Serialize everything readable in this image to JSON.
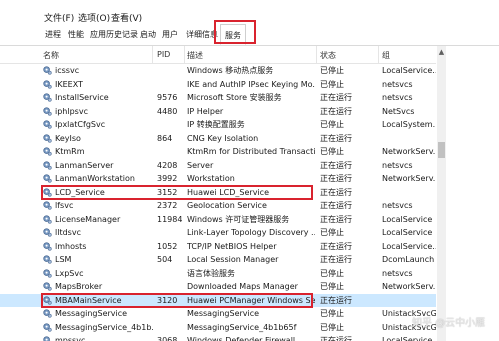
{
  "menu": {
    "file": "文件(F)",
    "options": "选项(O)",
    "view": "查看(V)"
  },
  "tabs": [
    "进程",
    "性能",
    "应用历史记录",
    "启动",
    "用户",
    "详细信息",
    "服务"
  ],
  "active_tab": "服务",
  "columns": {
    "name": "名称",
    "pid": "PID",
    "desc": "描述",
    "status": "状态",
    "group": "组"
  },
  "rows": [
    {
      "name": "icssvc",
      "pid": "",
      "desc": "Windows 移动热点服务",
      "status": "已停止",
      "group": "LocalService..."
    },
    {
      "name": "IKEEXT",
      "pid": "",
      "desc": "IKE and AuthIP IPsec Keying Mo...",
      "status": "已停止",
      "group": "netsvcs"
    },
    {
      "name": "InstallService",
      "pid": "9576",
      "desc": "Microsoft Store 安装服务",
      "status": "正在运行",
      "group": "netsvcs"
    },
    {
      "name": "iphlpsvc",
      "pid": "4480",
      "desc": "IP Helper",
      "status": "正在运行",
      "group": "NetSvcs"
    },
    {
      "name": "IpxlatCfgSvc",
      "pid": "",
      "desc": "IP 转换配置服务",
      "status": "已停止",
      "group": "LocalSystem..."
    },
    {
      "name": "KeyIso",
      "pid": "864",
      "desc": "CNG Key Isolation",
      "status": "正在运行",
      "group": ""
    },
    {
      "name": "KtmRm",
      "pid": "",
      "desc": "KtmRm for Distributed Transacti...",
      "status": "已停止",
      "group": "NetworkServ..."
    },
    {
      "name": "LanmanServer",
      "pid": "4208",
      "desc": "Server",
      "status": "正在运行",
      "group": "netsvcs"
    },
    {
      "name": "LanmanWorkstation",
      "pid": "3992",
      "desc": "Workstation",
      "status": "正在运行",
      "group": "NetworkServ..."
    },
    {
      "name": "LCD_Service",
      "pid": "3152",
      "desc": "Huawei LCD_Service",
      "status": "正在运行",
      "group": ""
    },
    {
      "name": "lfsvc",
      "pid": "2372",
      "desc": "Geolocation Service",
      "status": "正在运行",
      "group": "netsvcs"
    },
    {
      "name": "LicenseManager",
      "pid": "11984",
      "desc": "Windows 许可证管理器服务",
      "status": "正在运行",
      "group": "LocalService"
    },
    {
      "name": "lltdsvc",
      "pid": "",
      "desc": "Link-Layer Topology Discovery ...",
      "status": "已停止",
      "group": "LocalService"
    },
    {
      "name": "lmhosts",
      "pid": "1052",
      "desc": "TCP/IP NetBIOS Helper",
      "status": "正在运行",
      "group": "LocalService..."
    },
    {
      "name": "LSM",
      "pid": "504",
      "desc": "Local Session Manager",
      "status": "正在运行",
      "group": "DcomLaunch"
    },
    {
      "name": "LxpSvc",
      "pid": "",
      "desc": "语言体验服务",
      "status": "已停止",
      "group": "netsvcs"
    },
    {
      "name": "MapsBroker",
      "pid": "",
      "desc": "Downloaded Maps Manager",
      "status": "已停止",
      "group": "NetworkServ..."
    },
    {
      "name": "MBAMainService",
      "pid": "3120",
      "desc": "Huawei PCManager Windows Se...",
      "status": "正在运行",
      "group": ""
    },
    {
      "name": "MessagingService",
      "pid": "",
      "desc": "MessagingService",
      "status": "已停止",
      "group": "UnistackSvcG..."
    },
    {
      "name": "MessagingService_4b1b...",
      "pid": "",
      "desc": "MessagingService_4b1b65f",
      "status": "已停止",
      "group": "UnistackSvcG..."
    },
    {
      "name": "mpssvc",
      "pid": "3068",
      "desc": "Windows Defender Firewall",
      "status": "正在运行",
      "group": "LocalService..."
    }
  ],
  "watermark": "知乎 @云中小雁",
  "colors": {
    "highlight_box": "#d9232e",
    "selected_row": "#cce8ff"
  }
}
